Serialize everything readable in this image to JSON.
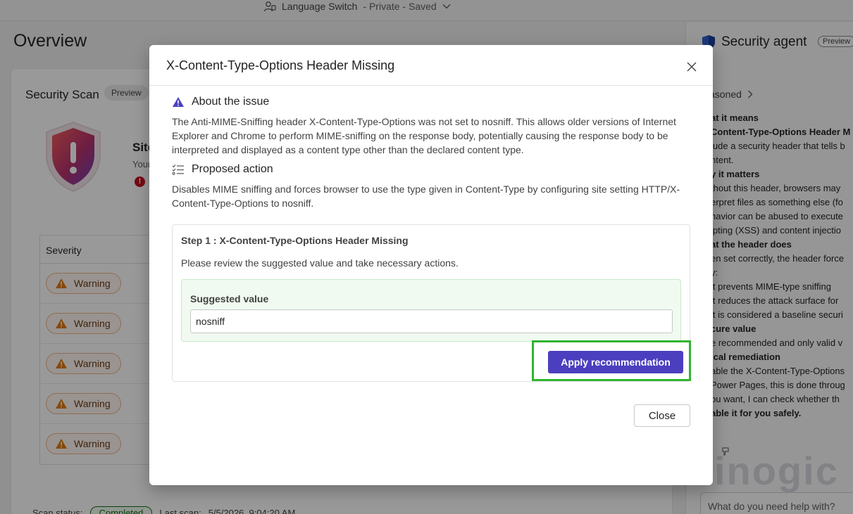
{
  "topbar": {
    "site_name": "Language Switch",
    "site_status": " - Private - Saved"
  },
  "page": {
    "title": "Overview"
  },
  "scan_card": {
    "title": "Security Scan",
    "badge": "Preview",
    "site_title": "Site",
    "site_sub": "Your",
    "error_glyph": "!",
    "table_header": "Severity",
    "rows": [
      "Warning",
      "Warning",
      "Warning",
      "Warning",
      "Warning"
    ],
    "status_label": "Scan status:",
    "status_value": "Completed",
    "last_scan_label": "Last scan:",
    "last_scan_value": "5/5/2026, 9:04:20 AM"
  },
  "agent_panel": {
    "title": "Security agent",
    "badge": "Preview",
    "reasoned": "asoned",
    "lines": [
      {
        "text": "at it means",
        "bold": true
      },
      {
        "text": "Content-Type-Options Header M",
        "bold": true
      },
      {
        "text": "lude a security header that tells b",
        "bold": false
      },
      {
        "text": "ntent.",
        "bold": false
      },
      {
        "text": "y it matters",
        "bold": true
      },
      {
        "text": "thout this header, browsers may",
        "bold": false
      },
      {
        "text": "erpret files as something else (fo",
        "bold": false
      },
      {
        "text": "havior can be abused to execute",
        "bold": false
      },
      {
        "text": "ipting (XSS) and content injectio",
        "bold": false
      },
      {
        "text": "at the header does",
        "bold": true
      },
      {
        "text": "en set correctly, the header force",
        "bold": false
      },
      {
        "text": "y:",
        "bold": false
      },
      {
        "text": "lt prevents MIME-type sniffing",
        "bold": false
      },
      {
        "text": "lt reduces the attack surface for",
        "bold": false
      },
      {
        "text": "lt is considered a baseline securi",
        "bold": false
      },
      {
        "text": "cure value",
        "bold": true
      },
      {
        "text": "e recommended and only valid v",
        "bold": false
      },
      {
        "text": "ical remediation",
        "bold": true
      },
      {
        "text": "able the X-Content-Type-Options",
        "bold": false
      },
      {
        "text": "Power Pages, this is done throug",
        "bold": false
      },
      {
        "text": "ou want, I can check whether th",
        "bold": false
      },
      {
        "text": "able it for you safely.",
        "bold": true
      }
    ],
    "watermark": "inogic",
    "input_placeholder": "What do you need help with?"
  },
  "dialog": {
    "title": "X-Content-Type-Options Header Missing",
    "about_heading": "About the issue",
    "about_text": "The Anti-MIME-Sniffing header X-Content-Type-Options was not set to nosniff. This allows older versions of Internet Explorer and Chrome to perform MIME-sniffing on the response body, potentially causing the response body to be interpreted and displayed as a content type other than the declared content type.",
    "action_heading": "Proposed action",
    "action_text": "Disables MIME sniffing and forces browser to use the type given in Content-Type by configuring site setting HTTP/X-Content-Type-Options to nosniff.",
    "step_title": "Step 1 : X-Content-Type-Options Header Missing",
    "step_desc": "Please review the suggested value and take necessary actions.",
    "suggested_label": "Suggested value",
    "suggested_value": "nosniff",
    "apply_label": "Apply recommendation",
    "close_label": "Close"
  },
  "colors": {
    "accent": "#4c3fbf",
    "highlight": "#2fb52f",
    "warning": "#e07a10",
    "suggest_bg": "#f1faf1"
  }
}
